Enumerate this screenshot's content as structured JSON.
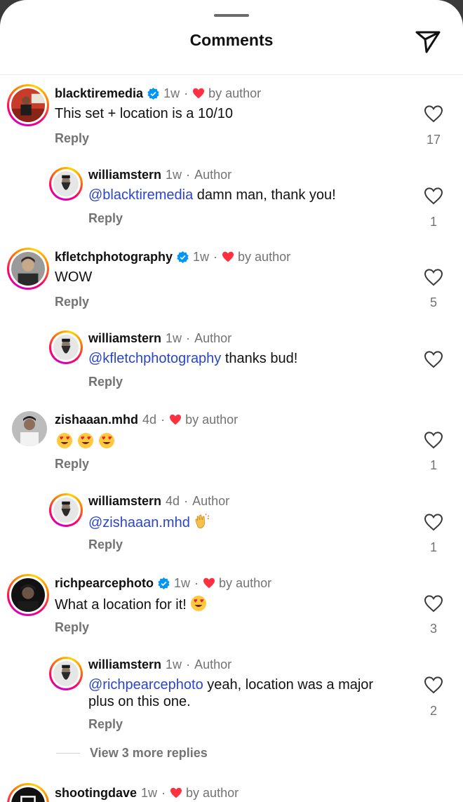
{
  "header": {
    "title": "Comments"
  },
  "icons": {
    "share": "paper-plane-icon",
    "like": "heart-outline-icon",
    "liked_by_author": "heart-filled-icon",
    "verified": "verified-badge-icon"
  },
  "colors": {
    "mention": "#2b45c9",
    "heart": "#ff3040",
    "verified": "#0095f6",
    "muted": "#737373"
  },
  "labels": {
    "reply": "Reply",
    "by_author": "by author",
    "author": "Author",
    "dot": "·"
  },
  "comments": [
    {
      "user": "blacktiremedia",
      "verified": true,
      "time": "1w",
      "liked_by_author": true,
      "text": "This set + location is a 10/10",
      "likes": "17"
    },
    {
      "user": "williamstern",
      "verified": false,
      "time": "1w",
      "is_author": true,
      "mention": "@blacktiremedia",
      "text": " damn man, thank you!",
      "likes": "1"
    },
    {
      "user": "kfletchphotography",
      "verified": true,
      "time": "1w",
      "liked_by_author": true,
      "text": "WOW",
      "likes": "5"
    },
    {
      "user": "williamstern",
      "verified": false,
      "time": "1w",
      "is_author": true,
      "mention": "@kfletchphotography",
      "text": " thanks bud!",
      "likes": ""
    },
    {
      "user": "zishaaan.mhd",
      "verified": false,
      "time": "4d",
      "liked_by_author": true,
      "emojis": [
        "heart-eyes-emoji",
        "heart-eyes-emoji",
        "heart-eyes-emoji"
      ],
      "likes": "1"
    },
    {
      "user": "williamstern",
      "verified": false,
      "time": "4d",
      "is_author": true,
      "mention": "@zishaaan.mhd",
      "emojis": [
        "clapping-hands-emoji"
      ],
      "likes": "1"
    },
    {
      "user": "richpearcephoto",
      "verified": true,
      "time": "1w",
      "liked_by_author": true,
      "text": "What a location for it! ",
      "emojis": [
        "heart-eyes-emoji"
      ],
      "likes": "3"
    },
    {
      "user": "williamstern",
      "verified": false,
      "time": "1w",
      "is_author": true,
      "mention": "@richpearcephoto",
      "text": " yeah, location was a major",
      "text_line2": "plus on this one.",
      "likes": "2"
    },
    {
      "user": "shootingdave",
      "verified": false,
      "time": "1w",
      "liked_by_author": true
    }
  ],
  "view_more_replies": "View 3 more replies"
}
